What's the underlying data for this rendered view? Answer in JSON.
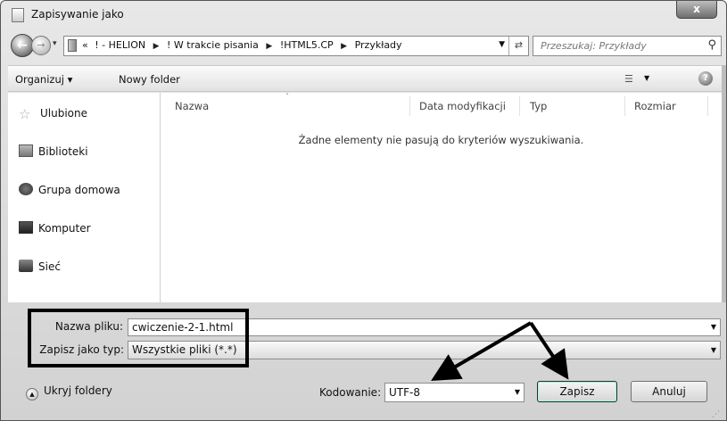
{
  "window": {
    "title": "Zapisywanie jako",
    "close_label": "x"
  },
  "nav": {
    "back_glyph": "←",
    "forward_glyph": "→",
    "breadcrumbs": [
      "«",
      "! - HELION",
      "! W trakcie pisania",
      "!HTML5.CP",
      "Przykłady"
    ],
    "search_placeholder": "Przeszukaj: Przykłady"
  },
  "toolbar": {
    "organize_label": "Organizuj ▾",
    "new_folder_label": "Nowy folder",
    "help_label": "?"
  },
  "sidebar": {
    "items": [
      {
        "label": "Ulubione",
        "icon": "star-icon"
      },
      {
        "label": "Biblioteki",
        "icon": "library-icon"
      },
      {
        "label": "Grupa domowa",
        "icon": "homegroup-icon"
      },
      {
        "label": "Komputer",
        "icon": "computer-icon"
      },
      {
        "label": "Sieć",
        "icon": "network-icon"
      }
    ]
  },
  "filelist": {
    "columns": [
      "Nazwa",
      "Data modyfikacji",
      "Typ",
      "Rozmiar"
    ],
    "empty_message": "Żadne elementy nie pasują do kryteriów wyszukiwania."
  },
  "form": {
    "filename_label": "Nazwa pliku:",
    "filename_value": "cwiczenie-2-1.html",
    "filetype_label": "Zapisz jako typ:",
    "filetype_value": "Wszystkie pliki  (*.*)",
    "hide_folders_label": "Ukryj foldery",
    "encoding_label": "Kodowanie:",
    "encoding_value": "UTF-8",
    "save_label": "Zapisz",
    "cancel_label": "Anuluj"
  },
  "colors": {
    "annotation": "#000000",
    "chrome": "#d8d8d8"
  }
}
